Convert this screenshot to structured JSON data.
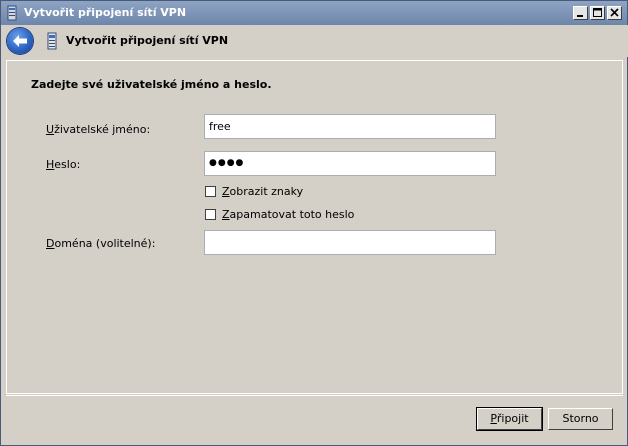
{
  "window": {
    "title": "Vytvořit připojení sítí VPN"
  },
  "nav": {
    "title": "Vytvořit připojení sítí VPN"
  },
  "main": {
    "heading": "Zadejte své uživatelské jméno a heslo.",
    "username_label_key": "U",
    "username_label_rest": "živatelské jméno:",
    "username_value": "free",
    "password_label_key": "H",
    "password_label_rest": "eslo:",
    "password_mask": "●●●●",
    "show_chars_key": "Z",
    "show_chars_rest": "obrazit znaky",
    "remember_key": "Z",
    "remember_rest": "apamatovat toto heslo",
    "domain_label_key": "D",
    "domain_label_rest": "oména (volitelné):",
    "domain_value": ""
  },
  "footer": {
    "connect_key": "P",
    "connect_rest": "řipojit",
    "cancel_label": "Storno"
  },
  "colors": {
    "titlebar": "#7a90b4",
    "window_bg": "#d4d0c8"
  },
  "icons": {
    "title_icon": "vpn-icon",
    "back_icon": "back-arrow-icon",
    "nav_icon": "vpn-icon"
  }
}
